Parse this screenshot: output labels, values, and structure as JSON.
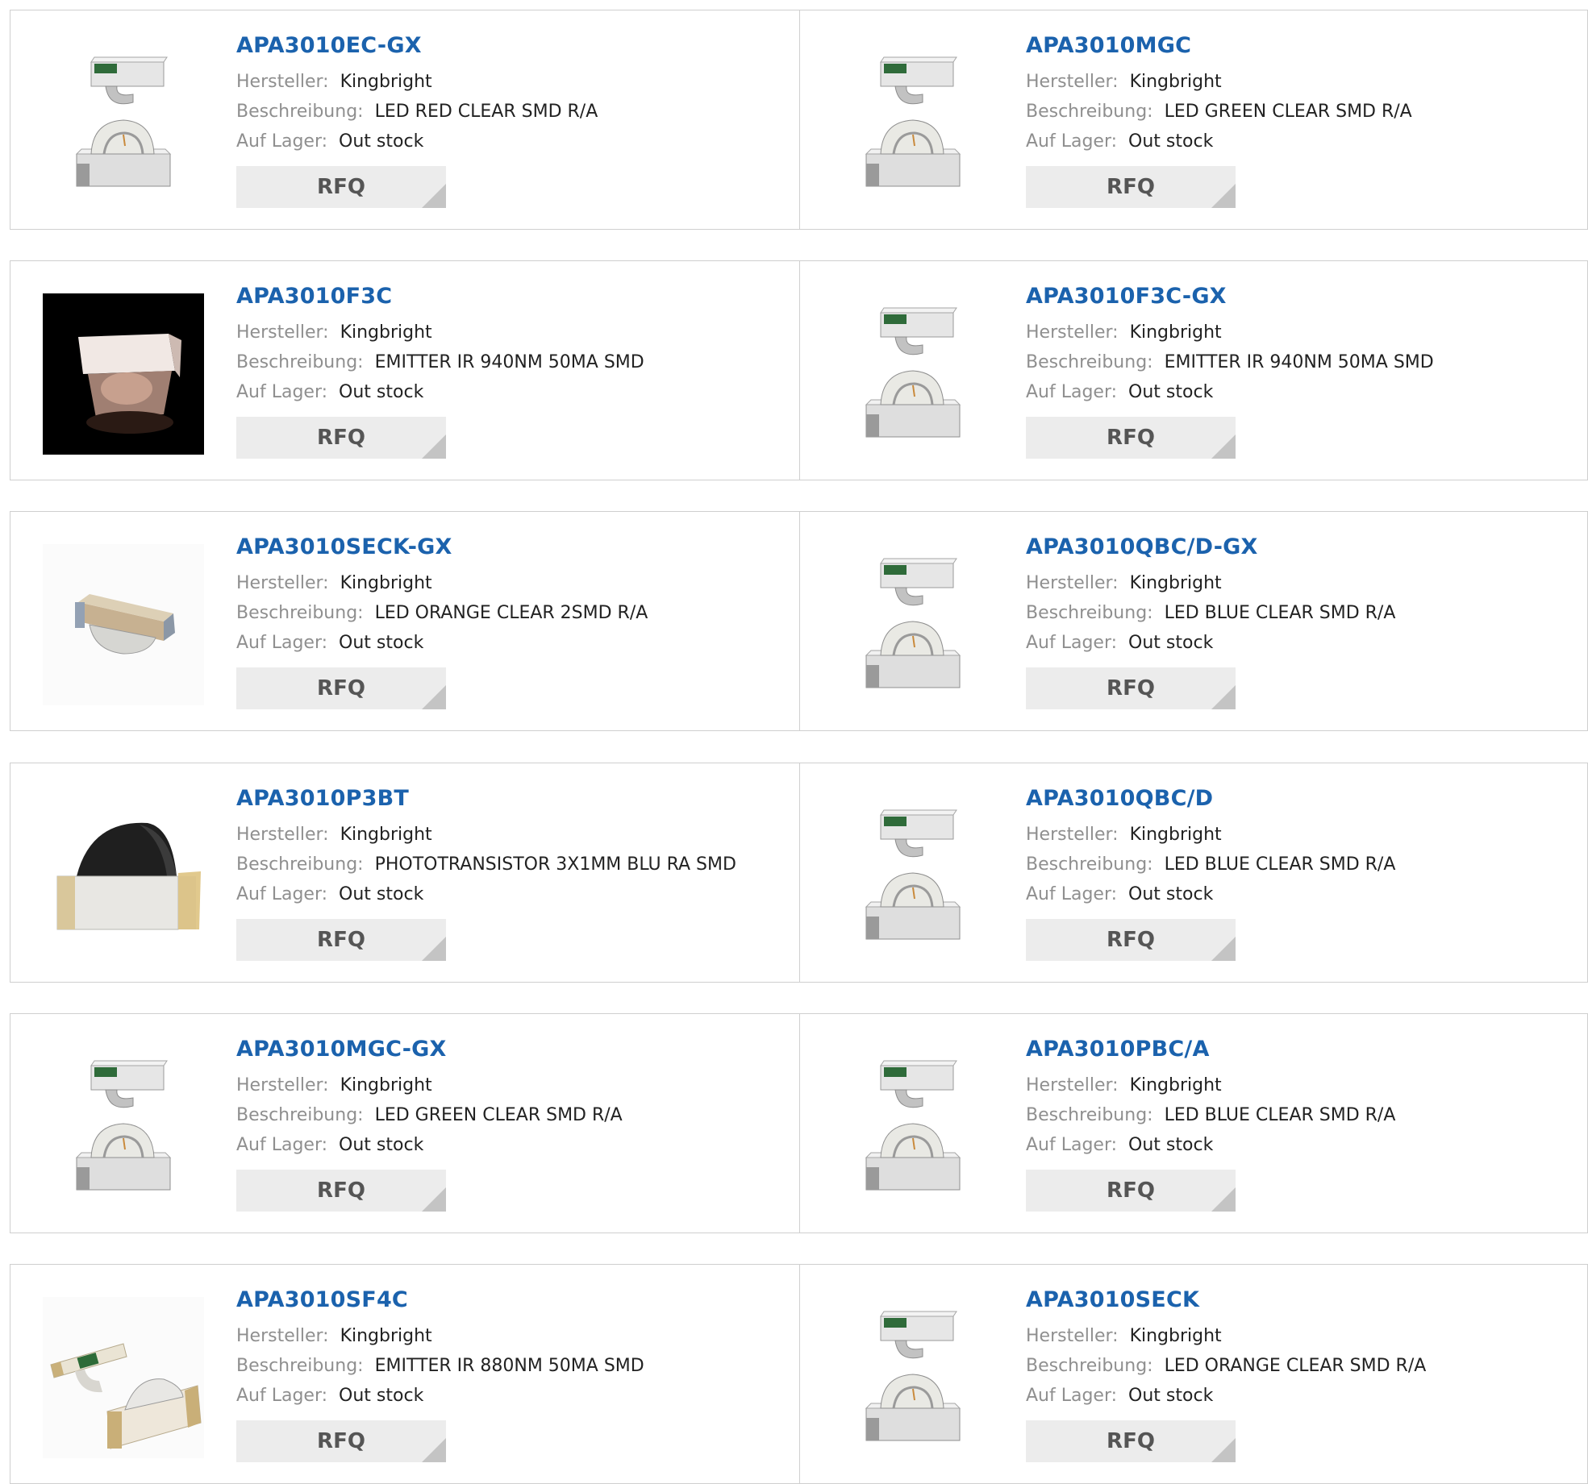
{
  "labels": {
    "manufacturer": "Hersteller:",
    "description": "Beschreibung:",
    "stock": "Auf Lager:"
  },
  "button_label": "RFQ",
  "link_color": "#1b62ad",
  "rows": [
    [
      {
        "part": "APA3010EC-GX",
        "manufacturer": "Kingbright",
        "description": "LED RED CLEAR SMD R/A",
        "stock": "Out stock",
        "image": "led-smd-ra"
      },
      {
        "part": "APA3010MGC",
        "manufacturer": "Kingbright",
        "description": "LED GREEN CLEAR SMD R/A",
        "stock": "Out stock",
        "image": "led-smd-ra"
      }
    ],
    [
      {
        "part": "APA3010F3C",
        "manufacturer": "Kingbright",
        "description": "EMITTER IR 940NM 50MA SMD",
        "stock": "Out stock",
        "image": "ir-emitter-photo"
      },
      {
        "part": "APA3010F3C-GX",
        "manufacturer": "Kingbright",
        "description": "EMITTER IR 940NM 50MA SMD",
        "stock": "Out stock",
        "image": "led-smd-ra"
      }
    ],
    [
      {
        "part": "APA3010SECK-GX",
        "manufacturer": "Kingbright",
        "description": "LED ORANGE CLEAR 2SMD R/A",
        "stock": "Out stock",
        "image": "led-orange-photo"
      },
      {
        "part": "APA3010QBC/D-GX",
        "manufacturer": "Kingbright",
        "description": "LED BLUE CLEAR SMD R/A",
        "stock": "Out stock",
        "image": "led-smd-ra"
      }
    ],
    [
      {
        "part": "APA3010P3BT",
        "manufacturer": "Kingbright",
        "description": "PHOTOTRANSISTOR 3X1MM BLU RA SMD",
        "stock": "Out stock",
        "image": "phototransistor"
      },
      {
        "part": "APA3010QBC/D",
        "manufacturer": "Kingbright",
        "description": "LED BLUE CLEAR SMD R/A",
        "stock": "Out stock",
        "image": "led-smd-ra"
      }
    ],
    [
      {
        "part": "APA3010MGC-GX",
        "manufacturer": "Kingbright",
        "description": "LED GREEN CLEAR SMD R/A",
        "stock": "Out stock",
        "image": "led-smd-ra"
      },
      {
        "part": "APA3010PBC/A",
        "manufacturer": "Kingbright",
        "description": "LED BLUE CLEAR SMD R/A",
        "stock": "Out stock",
        "image": "led-smd-ra"
      }
    ],
    [
      {
        "part": "APA3010SF4C",
        "manufacturer": "Kingbright",
        "description": "EMITTER IR 880NM 50MA SMD",
        "stock": "Out stock",
        "image": "ir-pair"
      },
      {
        "part": "APA3010SECK",
        "manufacturer": "Kingbright",
        "description": "LED ORANGE CLEAR SMD R/A",
        "stock": "Out stock",
        "image": "led-smd-ra"
      }
    ]
  ]
}
